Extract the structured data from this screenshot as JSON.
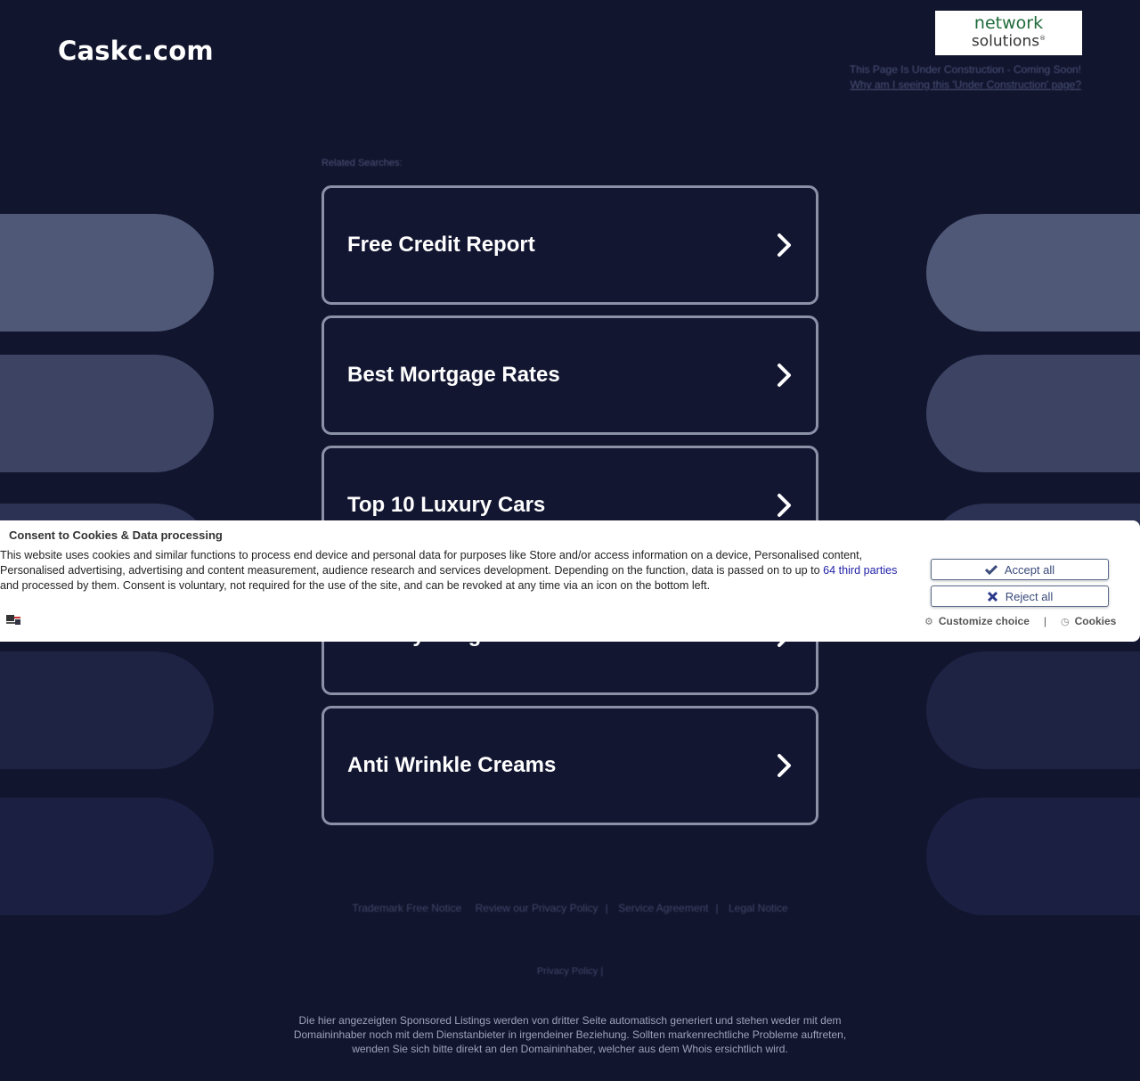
{
  "header": {
    "site_title": "Caskc.com",
    "logo": {
      "line1": "network",
      "line2": "solutions",
      "mark": "®"
    },
    "under_construction": "This Page Is Under Construction - Coming Soon!",
    "why_link": "Why am I seeing this 'Under Construction' page?"
  },
  "related": {
    "label": "Related Searches:",
    "items": [
      {
        "label": "Free Credit Report",
        "icon": "chevron-right-icon"
      },
      {
        "label": "Best Mortgage Rates",
        "icon": "chevron-right-icon"
      },
      {
        "label": "Top 10 Luxury Cars",
        "icon": "chevron-right-icon"
      },
      {
        "label": "Healthy Weight Loss",
        "icon": "chevron-right-icon"
      },
      {
        "label": "Anti Wrinkle Creams",
        "icon": "chevron-right-icon"
      }
    ]
  },
  "footer": {
    "links": [
      "Trademark Free Notice",
      "Review our Privacy Policy",
      "Service Agreement",
      "Legal Notice"
    ],
    "privacy": "Privacy Policy |",
    "disclaimer": "Die hier angezeigten Sponsored Listings werden von dritter Seite automatisch generiert und stehen weder mit dem Domaininhaber noch mit dem Dienstanbieter in irgendeiner Beziehung. Sollten markenrechtliche Probleme auftreten, wenden Sie sich bitte direkt an den Domaininhaber, welcher aus dem Whois ersichtlich wird."
  },
  "consent": {
    "title": "Consent to Cookies & Data processing",
    "body_before": "This website uses cookies and similar functions to process end device and personal data for purposes like Store and/or access information on a device, Personalised content, Personalised advertising, advertising and content measurement, audience research and services development. Depending on the function, data is passed on to up to ",
    "body_link": "64 third parties",
    "body_after": " and processed by them. Consent is voluntary, not required for the use of the site, and can be revoked at any time via an icon on the bottom left.",
    "accept_label": "Accept all",
    "reject_label": "Reject all",
    "customize_label": "Customize choice",
    "cookies_label": "Cookies",
    "separator": "|",
    "language_icon": "uk-flag-icon"
  },
  "colors": {
    "background": "#12152e",
    "box_border": "#8b91a6",
    "link_blue": "#2222aa",
    "brand_green": "#1f6b3a"
  }
}
